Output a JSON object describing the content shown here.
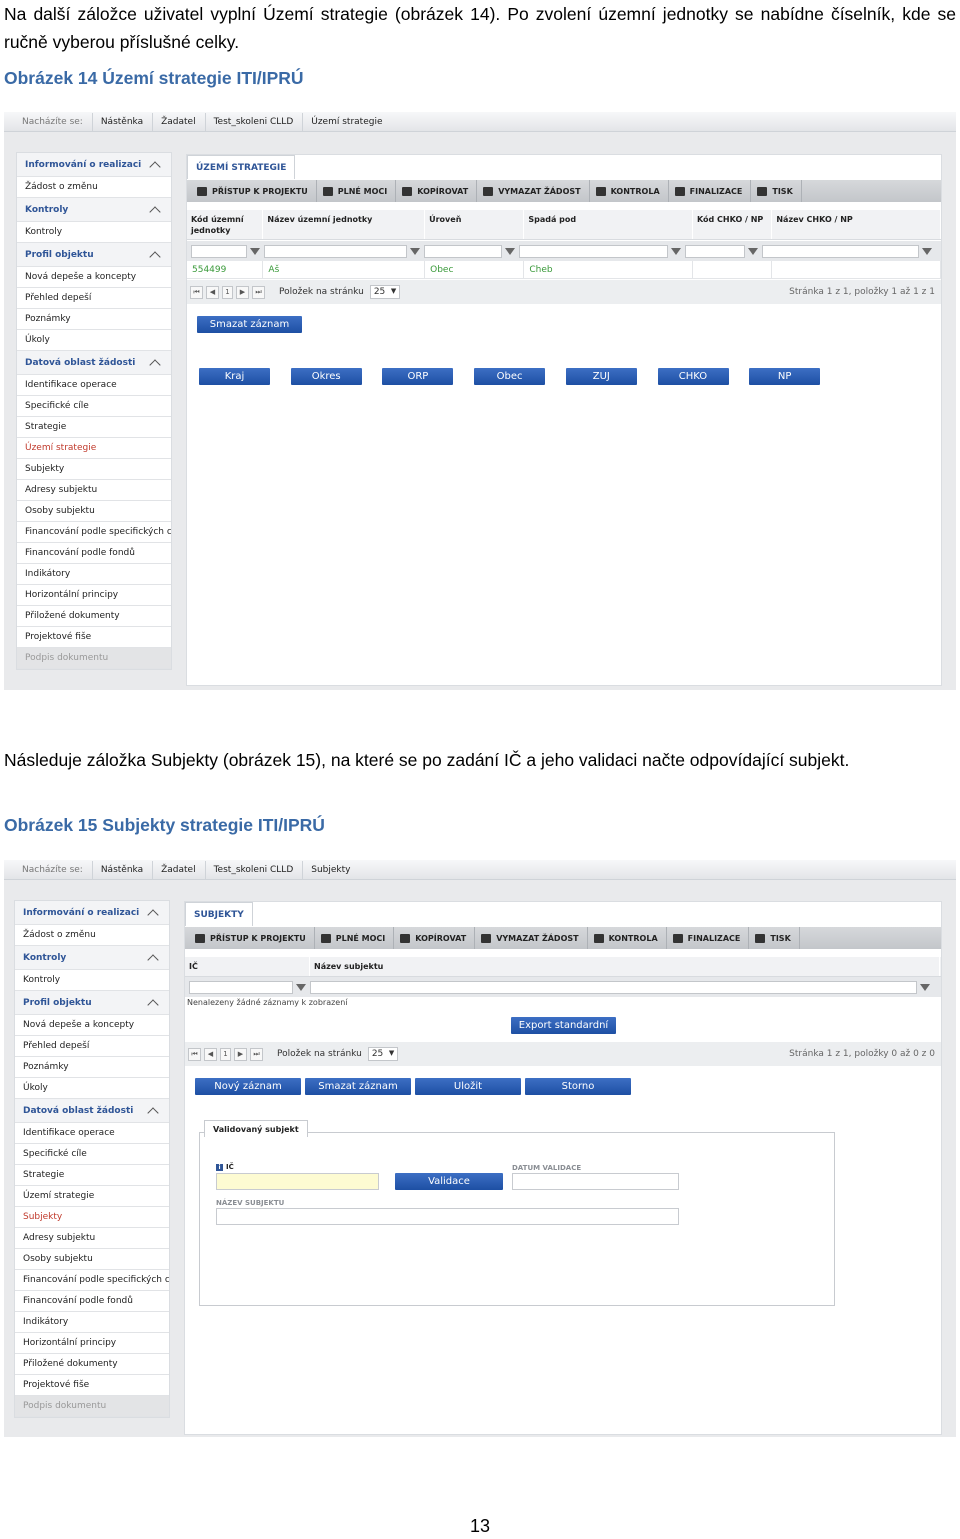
{
  "paragraphs": {
    "p1": "Na další záložce uživatel vyplní Území strategie (obrázek 14). Po zvolení územní jednotky se nabídne číselník, kde se ručně vyberou příslušné celky.",
    "p2": "Následuje záložka Subjekty (obrázek 15), na které se po zadání IČ a jeho validaci načte odpovídající subjekt."
  },
  "captions": {
    "fig14": "Obrázek 14 Území strategie ITI/IPRÚ",
    "fig15": "Obrázek 15 Subjekty strategie ITI/IPRÚ"
  },
  "page_number": "13",
  "sidebar": {
    "items": [
      {
        "label": "Informování o realizaci",
        "type": "header"
      },
      {
        "label": "Žádost o změnu",
        "type": "item"
      },
      {
        "label": "Kontroly",
        "type": "header"
      },
      {
        "label": "Kontroly",
        "type": "item"
      },
      {
        "label": "Profil objektu",
        "type": "header"
      },
      {
        "label": "Nová depeše a koncepty",
        "type": "item"
      },
      {
        "label": "Přehled depeší",
        "type": "item"
      },
      {
        "label": "Poznámky",
        "type": "item"
      },
      {
        "label": "Úkoly",
        "type": "item"
      },
      {
        "label": "Datová oblast žádosti",
        "type": "header"
      },
      {
        "label": "Identifikace operace",
        "type": "item"
      },
      {
        "label": "Specifické cíle",
        "type": "item"
      },
      {
        "label": "Strategie",
        "type": "item"
      },
      {
        "label": "Území strategie",
        "type": "item"
      },
      {
        "label": "Subjekty",
        "type": "item"
      },
      {
        "label": "Adresy subjektu",
        "type": "item"
      },
      {
        "label": "Osoby subjektu",
        "type": "item"
      },
      {
        "label": "Financování podle specifických cílů",
        "type": "item"
      },
      {
        "label": "Financování podle fondů",
        "type": "item"
      },
      {
        "label": "Indikátory",
        "type": "item"
      },
      {
        "label": "Horizontální principy",
        "type": "item"
      },
      {
        "label": "Přiložené dokumenty",
        "type": "item"
      },
      {
        "label": "Projektové fiše",
        "type": "item"
      },
      {
        "label": "Podpis dokumentu",
        "type": "disabled"
      }
    ]
  },
  "toolbar": [
    {
      "label": "PŘÍSTUP K PROJEKTU",
      "icon": "people-icon"
    },
    {
      "label": "PLNÉ MOCI",
      "icon": "mail-icon"
    },
    {
      "label": "KOPÍROVAT",
      "icon": "copy-icon"
    },
    {
      "label": "VYMAZAT ŽÁDOST",
      "icon": "delete-icon"
    },
    {
      "label": "KONTROLA",
      "icon": "check-icon"
    },
    {
      "label": "FINALIZACE",
      "icon": "lock-icon"
    },
    {
      "label": "TISK",
      "icon": "print-icon"
    }
  ],
  "shot1": {
    "breadcrumb": [
      "Nacházíte se:",
      "Nástěnka",
      "Žadatel",
      "Test_skoleni CLLD",
      "Území strategie"
    ],
    "tab": "ÚZEMÍ STRATEGIE",
    "columns": [
      "Kód územní jednotky",
      "Název územní jednotky",
      "Úroveň",
      "Spadá pod",
      "Kód CHKO / NP",
      "Název CHKO / NP"
    ],
    "row": [
      "554499",
      "Aš",
      "Obec",
      "Cheb",
      "",
      ""
    ],
    "pager": {
      "page": "1",
      "per_page_label": "Položek na stránku",
      "per_page": "25",
      "info": "Stránka 1 z 1, položky 1 až 1 z 1"
    },
    "delete_button": "Smazat záznam",
    "unit_buttons": [
      "Kraj",
      "Okres",
      "ORP",
      "Obec",
      "ZUJ",
      "CHKO",
      "NP"
    ],
    "active_sidebar": "Území strategie"
  },
  "shot2": {
    "breadcrumb": [
      "Nacházíte se:",
      "Nástěnka",
      "Žadatel",
      "Test_skoleni CLLD",
      "Subjekty"
    ],
    "tab": "SUBJEKTY",
    "columns": [
      "IČ",
      "Název subjektu"
    ],
    "empty_message": "Nenalezeny žádné záznamy k zobrazení",
    "export_button": "Export standardní",
    "pager": {
      "page": "1",
      "per_page_label": "Položek na stránku",
      "per_page": "25",
      "info": "Stránka 1 z 1, položky 0 až 0 z 0"
    },
    "action_buttons": [
      "Nový záznam",
      "Smazat záznam",
      "Uložit",
      "Storno"
    ],
    "form": {
      "tab": "Validovaný subjekt",
      "ic_label": "IČ",
      "validate_button": "Validace",
      "date_label": "DATUM VALIDACE",
      "name_label": "NÁZEV SUBJEKTU"
    },
    "active_sidebar": "Subjekty"
  }
}
